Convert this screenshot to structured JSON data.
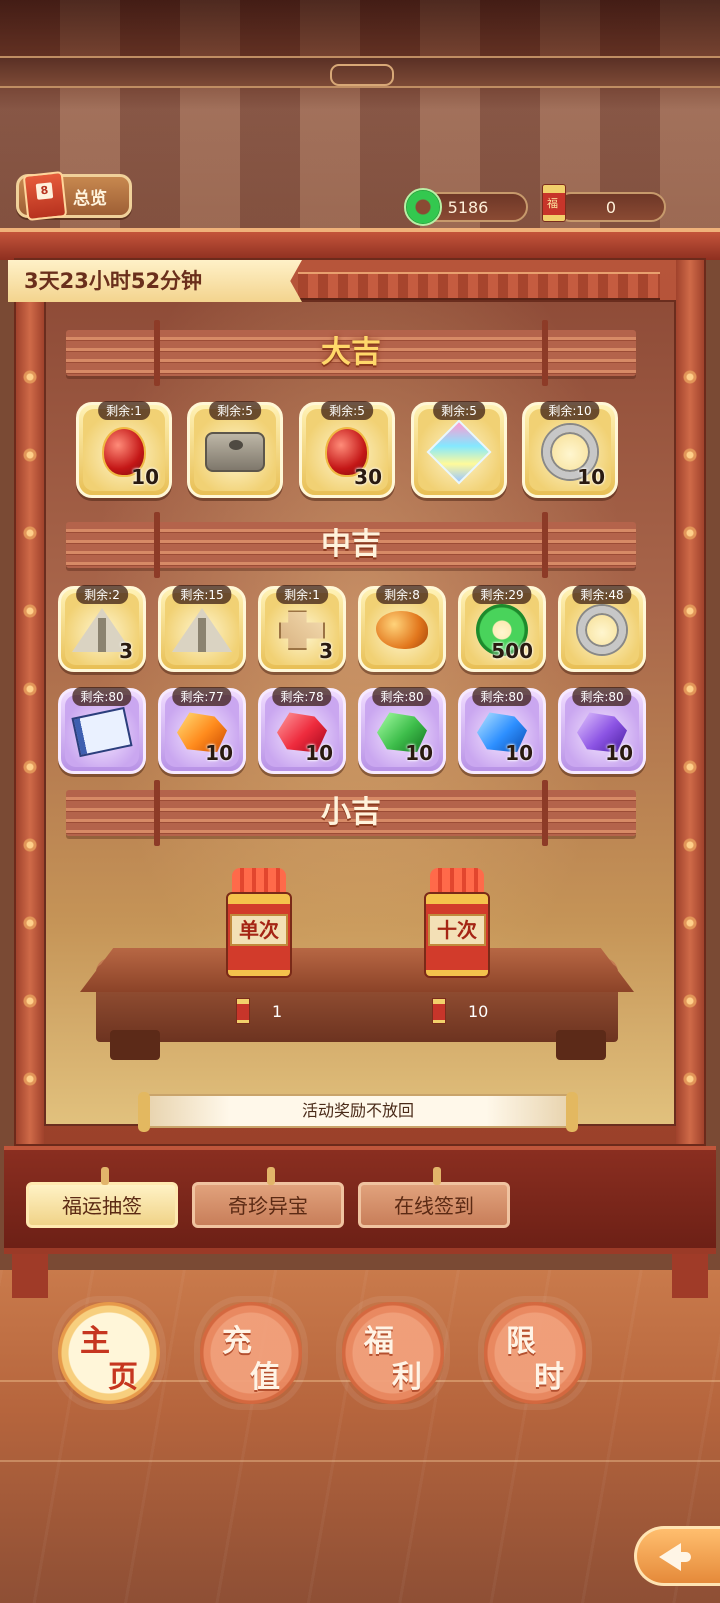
{
  "hud": {
    "overview_label": "总览",
    "jade_count": "5186",
    "lot_count": "0"
  },
  "timer": "3天23小时52分钟",
  "tiers": {
    "top": "大吉",
    "mid": "中吉",
    "low": "小吉"
  },
  "tier_top_items": [
    {
      "remain": "剩余:1",
      "qty": "10",
      "icon": "red-pouch-icon"
    },
    {
      "remain": "剩余:5",
      "qty": "",
      "icon": "millstone-icon"
    },
    {
      "remain": "剩余:5",
      "qty": "30",
      "icon": "red-pouch-icon"
    },
    {
      "remain": "剩余:5",
      "qty": "",
      "icon": "rainbow-gem-icon"
    },
    {
      "remain": "剩余:10",
      "qty": "10",
      "icon": "silver-ring-icon"
    }
  ],
  "tier_mid_items_row1": [
    {
      "remain": "剩余:2",
      "qty": "3",
      "icon": "tent-icon"
    },
    {
      "remain": "剩余:15",
      "qty": "",
      "icon": "tent-icon"
    },
    {
      "remain": "剩余:1",
      "qty": "3",
      "icon": "wooden-puzzle-icon"
    },
    {
      "remain": "剩余:8",
      "qty": "",
      "icon": "amber-icon"
    },
    {
      "remain": "剩余:29",
      "qty": "500",
      "icon": "jade-coin-icon"
    },
    {
      "remain": "剩余:48",
      "qty": "",
      "icon": "silver-ring-icon"
    }
  ],
  "tier_mid_items_row2": [
    {
      "remain": "剩余:80",
      "qty": "",
      "icon": "book-icon"
    },
    {
      "remain": "剩余:77",
      "qty": "10",
      "icon": "orange-crystal-icon"
    },
    {
      "remain": "剩余:78",
      "qty": "10",
      "icon": "red-crystal-icon"
    },
    {
      "remain": "剩余:80",
      "qty": "10",
      "icon": "green-crystal-icon"
    },
    {
      "remain": "剩余:80",
      "qty": "10",
      "icon": "blue-crystal-icon"
    },
    {
      "remain": "剩余:80",
      "qty": "10",
      "icon": "violet-crystal-icon"
    }
  ],
  "draw": {
    "single_label": "单次",
    "ten_label": "十次",
    "single_cost": "1",
    "ten_cost": "10"
  },
  "notice": "活动奖励不放回",
  "tabs": [
    "福运抽签",
    "奇珍异宝",
    "在线签到"
  ],
  "nav": [
    {
      "c1": "主",
      "c2": "页"
    },
    {
      "c1": "充",
      "c2": "值"
    },
    {
      "c1": "福",
      "c2": "利"
    },
    {
      "c1": "限",
      "c2": "时"
    }
  ],
  "colors": {
    "frame_red": "#b7553a",
    "gold_card": "#e8bf55",
    "purple_card": "#b892e6",
    "tier_gold_text": "#ffd86a"
  }
}
